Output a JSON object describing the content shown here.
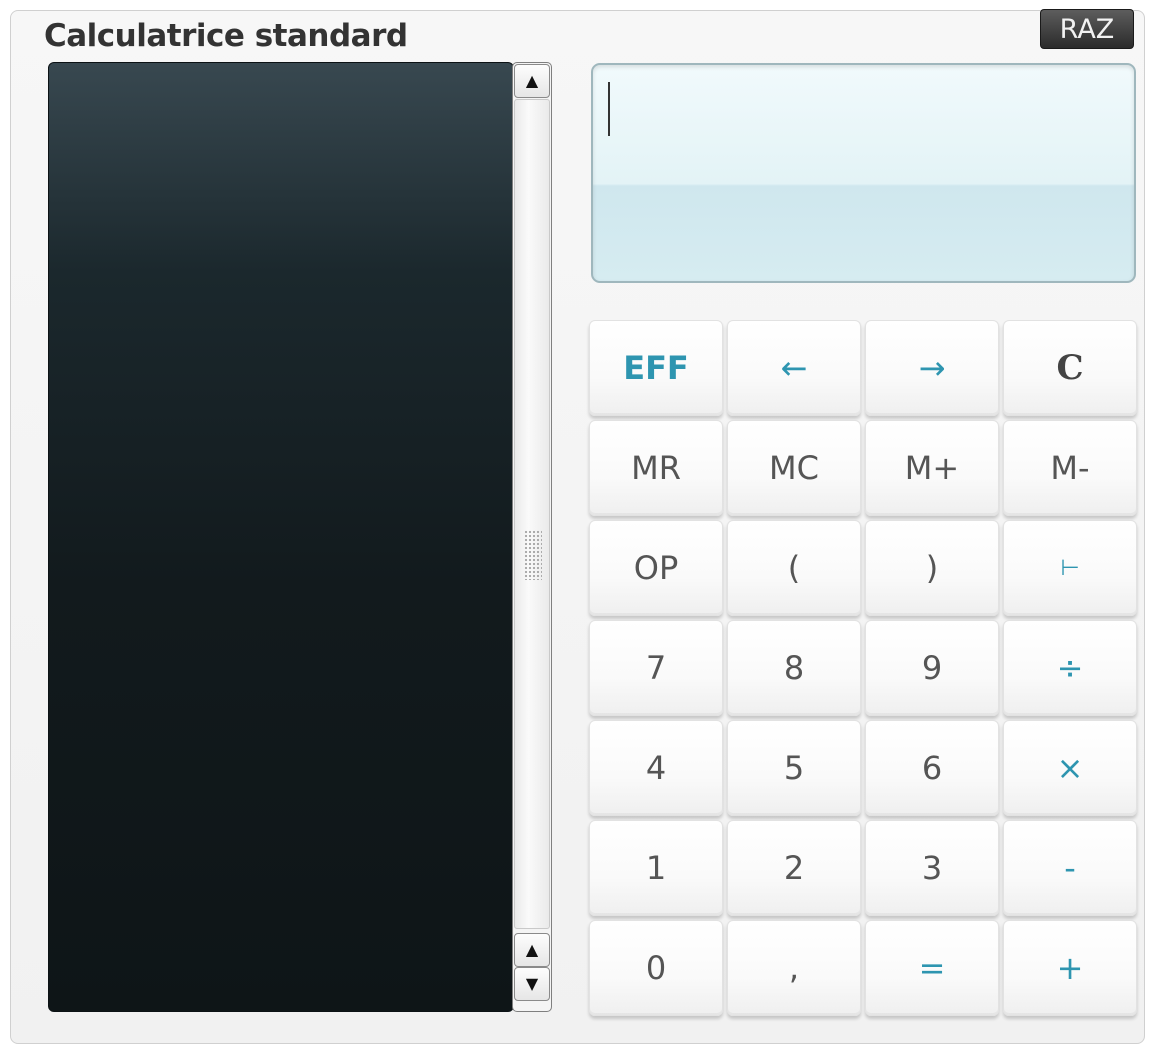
{
  "window": {
    "title": "Calculatrice standard",
    "reset_label": "RAZ"
  },
  "display": {
    "value": ""
  },
  "keys": [
    {
      "label": "EFF",
      "style": "accent",
      "name": "clear-entry-button"
    },
    {
      "label": "←",
      "style": "accent",
      "name": "cursor-left-button"
    },
    {
      "label": "→",
      "style": "accent",
      "name": "cursor-right-button"
    },
    {
      "label": "C",
      "style": "serif",
      "name": "clear-button"
    },
    {
      "label": "MR",
      "style": "normal",
      "name": "memory-recall-button"
    },
    {
      "label": "MC",
      "style": "normal",
      "name": "memory-clear-button"
    },
    {
      "label": "M+",
      "style": "normal",
      "name": "memory-add-button"
    },
    {
      "label": "M-",
      "style": "normal",
      "name": "memory-subtract-button"
    },
    {
      "label": "OP",
      "style": "normal",
      "name": "opposite-button"
    },
    {
      "label": "(",
      "style": "normal",
      "name": "open-paren-button"
    },
    {
      "label": ")",
      "style": "normal",
      "name": "close-paren-button"
    },
    {
      "label": "⊢",
      "style": "accent",
      "name": "fraction-button"
    },
    {
      "label": "7",
      "style": "normal",
      "name": "digit-7-button"
    },
    {
      "label": "8",
      "style": "normal",
      "name": "digit-8-button"
    },
    {
      "label": "9",
      "style": "normal",
      "name": "digit-9-button"
    },
    {
      "label": "÷",
      "style": "accent",
      "name": "divide-button"
    },
    {
      "label": "4",
      "style": "normal",
      "name": "digit-4-button"
    },
    {
      "label": "5",
      "style": "normal",
      "name": "digit-5-button"
    },
    {
      "label": "6",
      "style": "normal",
      "name": "digit-6-button"
    },
    {
      "label": "×",
      "style": "accent",
      "name": "multiply-button"
    },
    {
      "label": "1",
      "style": "normal",
      "name": "digit-1-button"
    },
    {
      "label": "2",
      "style": "normal",
      "name": "digit-2-button"
    },
    {
      "label": "3",
      "style": "normal",
      "name": "digit-3-button"
    },
    {
      "label": "-",
      "style": "accent",
      "name": "subtract-button"
    },
    {
      "label": "0",
      "style": "normal",
      "name": "digit-0-button"
    },
    {
      "label": ",",
      "style": "normal",
      "name": "decimal-comma-button"
    },
    {
      "label": "=",
      "style": "accent",
      "name": "equals-button"
    },
    {
      "label": "+",
      "style": "accent",
      "name": "add-button"
    }
  ],
  "scrollbar": {
    "up_icon": "triangle-up",
    "down_icon": "triangle-down"
  },
  "colors": {
    "accent": "#2e95b0",
    "key_text": "#555555",
    "history_bg": "#121a1d",
    "display_bg": "#e3f3f6"
  }
}
